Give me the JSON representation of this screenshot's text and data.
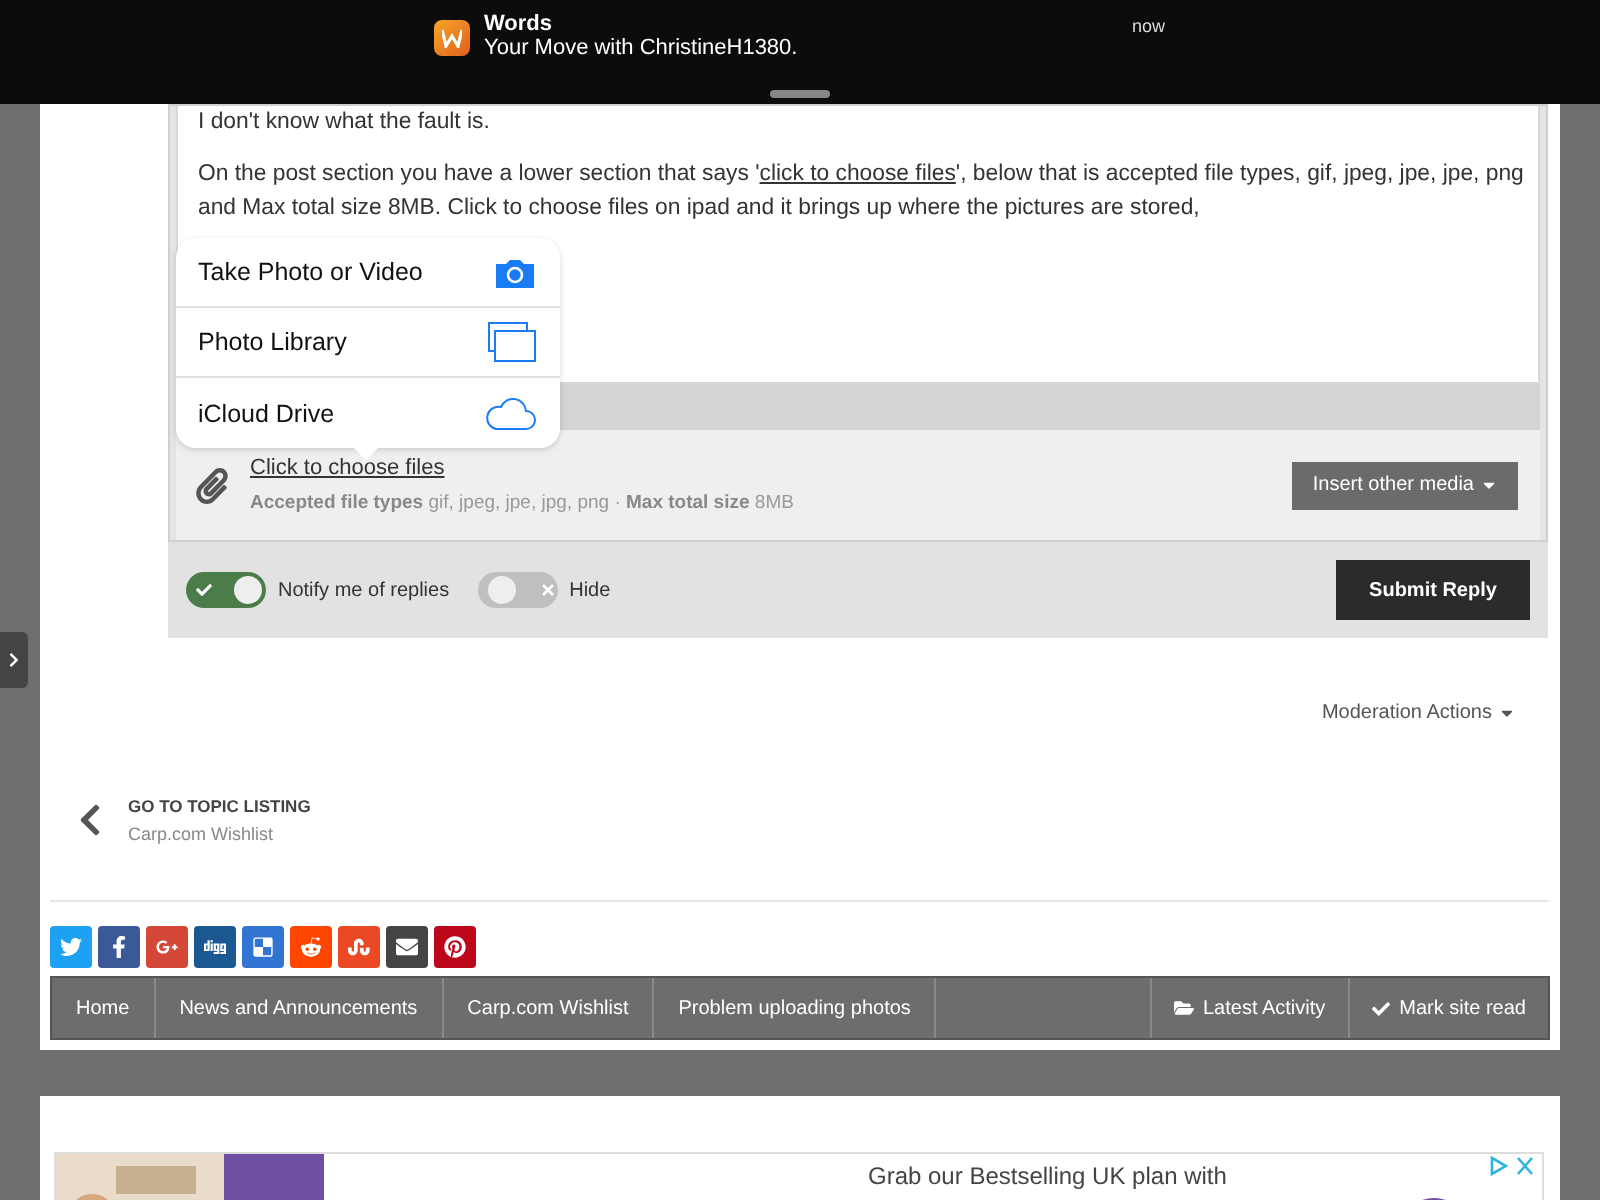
{
  "notification": {
    "app": "Words",
    "message": "Your Move with ChristineH1380.",
    "time": "now"
  },
  "post": {
    "paragraphs": [
      {
        "before": "I don't know what the fault is."
      },
      {
        "before": "On the post section you have a lower section that says '",
        "link": "click to choose files",
        "after": "', below that is accepted file types, gif, jpeg, jpe, jpe, png and Max total size 8MB. Click to choose files on ipad and it brings up where the pictures are stored,"
      }
    ]
  },
  "popover": {
    "items": [
      {
        "label": "Take Photo or Video",
        "kind": "camera"
      },
      {
        "label": "Photo Library",
        "kind": "library"
      },
      {
        "label": "iCloud Drive",
        "kind": "cloud"
      }
    ]
  },
  "attachments": {
    "link": "Click to choose files",
    "info": "**Accepted file types** gif, jpeg, jpe, jpg, png · **Max total size** 8MB",
    "insert_button": "Insert other media"
  },
  "toggles": [
    {
      "label": "Notify me of replies",
      "on": true
    },
    {
      "label": "Hide",
      "on": false
    }
  ],
  "submit_button": "Submit Reply",
  "moderation": "Moderation Actions",
  "topic_nav": {
    "heading": "GO TO TOPIC LISTING",
    "subtitle": "Carp.com Wishlist"
  },
  "share": [
    {
      "kind": "twitter",
      "color": "#1da1f2"
    },
    {
      "kind": "facebook",
      "color": "#3b5998"
    },
    {
      "kind": "google",
      "color": "#d34836"
    },
    {
      "kind": "digg",
      "color": "#1b5891"
    },
    {
      "kind": "delicious",
      "color": "#3274d1"
    },
    {
      "kind": "reddit",
      "color": "#ff4500"
    },
    {
      "kind": "stumbleupon",
      "color": "#eb4924"
    },
    {
      "kind": "email",
      "color": "#444444"
    },
    {
      "kind": "pinterest",
      "color": "#bd081c"
    }
  ],
  "breadcrumb": {
    "items": [
      "Home",
      "News and Announcements",
      "Carp.com Wishlist",
      "Problem uploading photos"
    ],
    "actions": [
      {
        "label": "Latest Activity",
        "kind": "folder"
      },
      {
        "label": "Mark site read",
        "kind": "check"
      }
    ]
  },
  "ad": {
    "text": "Grab our Bestselling UK plan with"
  }
}
